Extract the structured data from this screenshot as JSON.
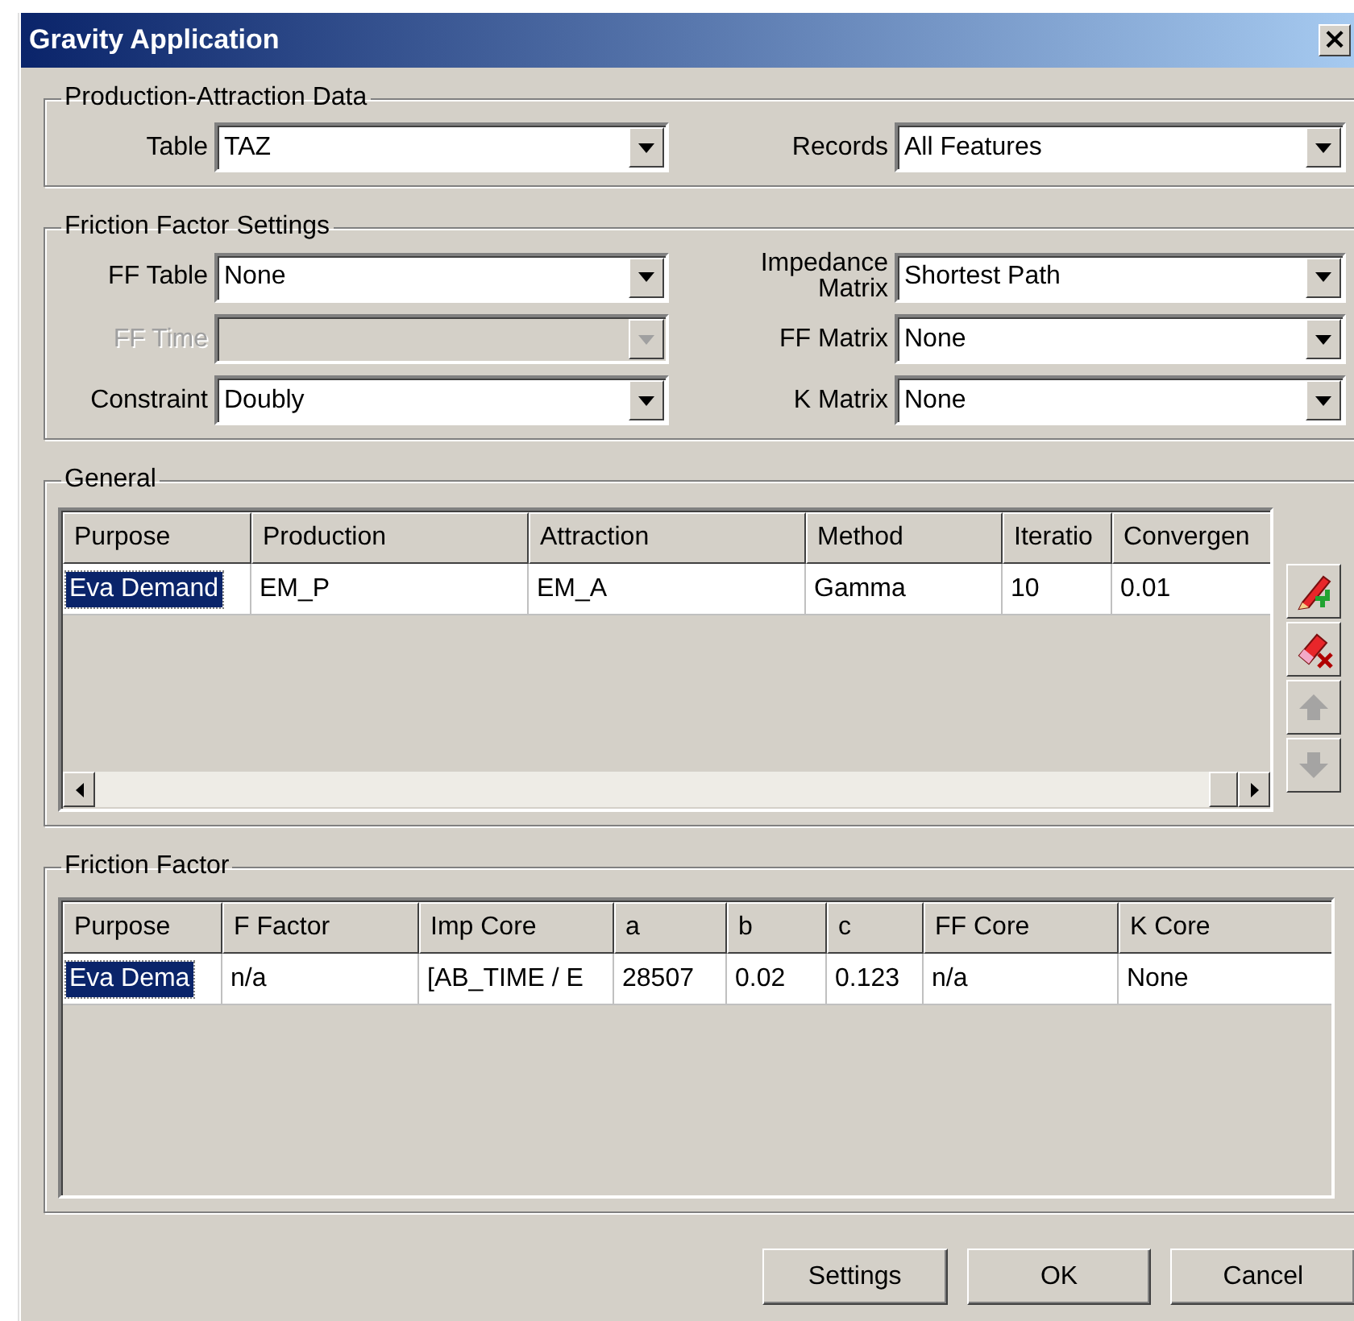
{
  "window": {
    "title": "Gravity Application",
    "close": "×"
  },
  "production_attraction": {
    "legend": "Production-Attraction Data",
    "left": [
      {
        "label": "Table",
        "value": "TAZ",
        "disabled": false
      }
    ],
    "right": [
      {
        "label": "Records",
        "value": "All Features",
        "disabled": false
      }
    ]
  },
  "friction_settings": {
    "legend": "Friction Factor Settings",
    "left": [
      {
        "label": "FF Table",
        "value": "None",
        "disabled": false
      },
      {
        "label": "FF Time",
        "disabled": true
      },
      {
        "label": "Constraint",
        "value": "Doubly",
        "disabled": false
      }
    ],
    "right": [
      {
        "label": "Impedance Matrix",
        "value": "Shortest Path",
        "disabled": false
      },
      {
        "label": "FF Matrix",
        "value": "None",
        "disabled": false
      },
      {
        "label": "K Matrix",
        "value": "None",
        "disabled": false
      }
    ]
  },
  "general": {
    "legend": "General",
    "columns": [
      "Purpose",
      "Production",
      "Attraction",
      "Method",
      "Iteratio",
      "Convergen"
    ],
    "rows": [
      {
        "selected": true,
        "cells": [
          "Eva Demand",
          "EM_P",
          "EM_A",
          "Gamma",
          "10",
          "0.01"
        ]
      }
    ],
    "side_buttons": [
      {
        "kind": "add",
        "disabled": false
      },
      {
        "kind": "delete",
        "disabled": false
      },
      {
        "kind": "up",
        "disabled": true
      },
      {
        "kind": "down",
        "disabled": true
      }
    ]
  },
  "friction_factor": {
    "legend": "Friction Factor",
    "columns": [
      "Purpose",
      "F Factor",
      "Imp Core",
      "a",
      "b",
      "c",
      "FF Core",
      "K Core"
    ],
    "rows": [
      {
        "selected": true,
        "cells": [
          "Eva Dema",
          "n/a",
          "[AB_TIME / E",
          "28507",
          "0.02",
          "0.123",
          "n/a",
          "None"
        ]
      }
    ]
  },
  "buttons": [
    "Settings",
    "OK",
    "Cancel"
  ]
}
